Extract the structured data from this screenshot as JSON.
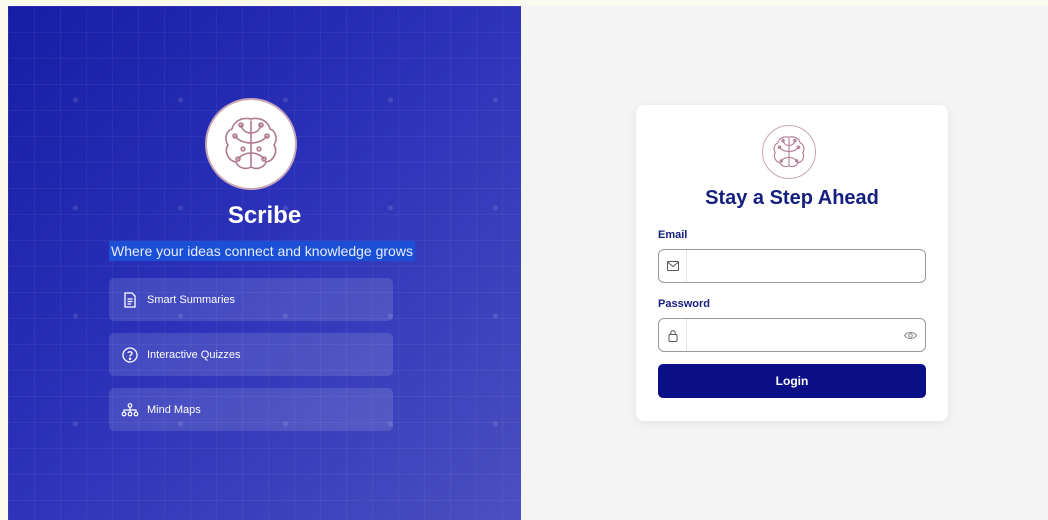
{
  "brand": {
    "name": "Scribe",
    "tagline": "Where your ideas connect and knowledge grows",
    "logo_icon": "brain-circuit-icon"
  },
  "features": [
    {
      "label": "Smart Summaries",
      "icon": "document-icon"
    },
    {
      "label": "Interactive Quizzes",
      "icon": "question-circle-icon"
    },
    {
      "label": "Mind Maps",
      "icon": "hierarchy-icon"
    }
  ],
  "login": {
    "title": "Stay a Step Ahead",
    "email_label": "Email",
    "email_value": "",
    "password_label": "Password",
    "password_value": "",
    "button_label": "Login"
  },
  "colors": {
    "panel_gradient_start": "#171ea6",
    "panel_gradient_end": "#4a4fc0",
    "primary": "#0b0f86",
    "title": "#15207e",
    "tagline_highlight": "#1a4fd6",
    "logo_stroke": "#b07a93"
  }
}
